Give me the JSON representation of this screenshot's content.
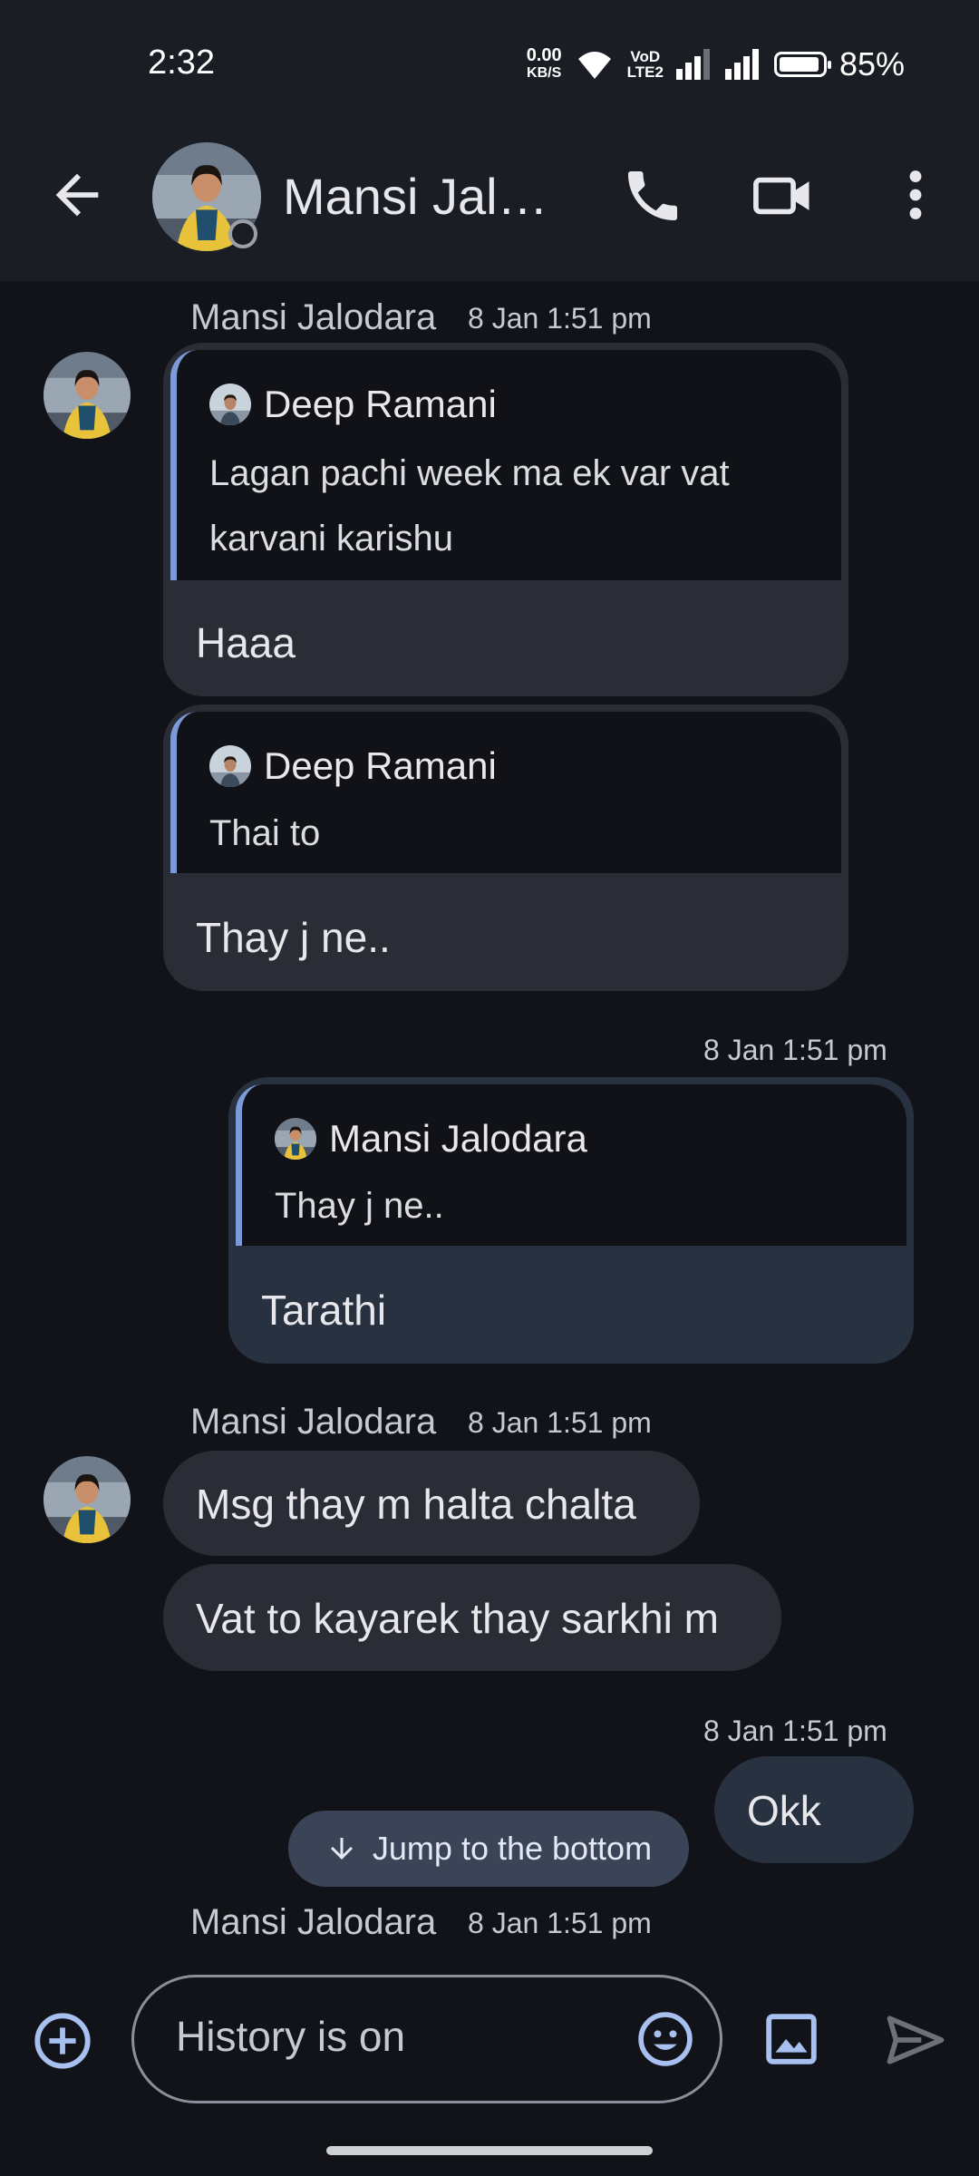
{
  "status_bar": {
    "time": "2:32",
    "net_speed_value": "0.00",
    "net_speed_unit": "KB/S",
    "volte_top": "VoD",
    "volte_bottom": "LTE2",
    "battery": "85%"
  },
  "header": {
    "title": "Mansi Jalo…",
    "icons": [
      "back-arrow-icon",
      "phone-icon",
      "video-call-icon",
      "more-vert-icon"
    ]
  },
  "messages": [
    {
      "sender": "Mansi Jalodara",
      "time": "8 Jan 1:51 pm",
      "quote_sender": "Deep Ramani",
      "quote_line1": "Lagan pachi week ma ek var vat",
      "quote_line2": "karvani karishu",
      "text": "Haaa"
    },
    {
      "quote_sender": "Deep Ramani",
      "quote_text": "Thai to",
      "text": "Thay j ne.."
    },
    {
      "own": true,
      "time": "8 Jan 1:51 pm",
      "quote_sender": "Mansi Jalodara",
      "quote_text": "Thay j ne..",
      "text": "Tarathi"
    },
    {
      "sender": "Mansi Jalodara",
      "time": "8 Jan 1:51 pm",
      "text": "Msg thay m halta chalta"
    },
    {
      "text": "Vat to kayarek thay sarkhi m"
    },
    {
      "own": true,
      "time": "8 Jan 1:51 pm",
      "text": "Okk"
    },
    {
      "sender": "Mansi Jalodara",
      "time": "8 Jan 1:51 pm"
    }
  ],
  "jump_button": "Jump to the bottom",
  "composer": {
    "placeholder": "History is on"
  },
  "colors": {
    "background": "#111318",
    "bar": "#1a1d23",
    "bubble": "#2a2d35",
    "bubble_own": "#283140",
    "accent": "#a8c0f0",
    "quote_bar": "#7c9ad8"
  }
}
